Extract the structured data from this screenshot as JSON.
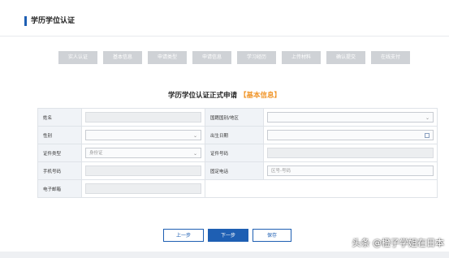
{
  "page": {
    "section_title": "学历学位认证",
    "form_title": "学历学位认证正式申请",
    "form_title_highlight": "【基本信息】"
  },
  "steps": [
    "实人认证",
    "基本信息",
    "申请类型",
    "申请信息",
    "学习经历",
    "上传材料",
    "确认提交",
    "在线支付"
  ],
  "fields": {
    "name_label": "姓名",
    "nationality_label": "国籍国别/地区",
    "gender_label": "性别",
    "birthdate_label": "出生日期",
    "id_type_label": "证件类型",
    "id_type_value": "身份证",
    "id_number_label": "证件号码",
    "mobile_label": "手机号码",
    "landline_label": "固定电话",
    "landline_placeholder": "区号-号码",
    "email_label": "电子邮箱"
  },
  "buttons": {
    "prev": "上一步",
    "next": "下一步",
    "save": "保存"
  },
  "colors": {
    "primary": "#1e5fb3",
    "highlight": "#f0962b",
    "step_inactive": "#cfd2d6"
  },
  "watermark": "头条 @橙子学姐在日本"
}
